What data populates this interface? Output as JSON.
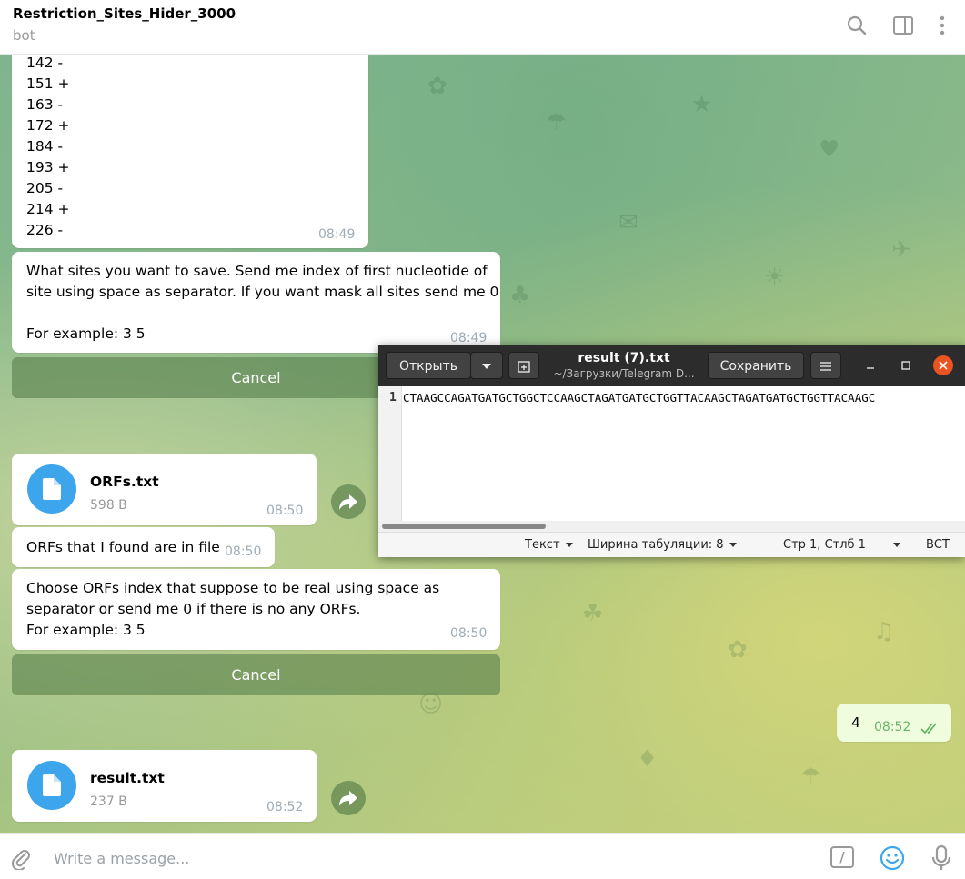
{
  "header": {
    "title": "Restriction_Sites_Hider_3000",
    "subtitle": "bot"
  },
  "messages": {
    "sites_list": {
      "lines": [
        "142 -",
        "151 +",
        "163 -",
        "172 +",
        "184 -",
        "193 +",
        "205 -",
        "214 +",
        "226 -"
      ],
      "time": "08:49"
    },
    "save_prompt": {
      "text": "What sites you want to save. Send me index of first nucleotide of\nsite using space as separator. If you want mask all sites send me 0\n\nFor example: 3 5",
      "time": "08:49",
      "button": "Cancel"
    },
    "orfs_file": {
      "name": "ORFs.txt",
      "size": "598 B",
      "time": "08:50"
    },
    "orfs_found": {
      "text": "ORFs that I found are in file",
      "time": "08:50"
    },
    "orfs_prompt": {
      "text": "Choose ORFs index that suppose to be real using space as\nseparator or send me 0 if there is no any ORFs.\nFor example: 3 5",
      "time": "08:50",
      "button": "Cancel"
    },
    "user_reply": {
      "text": "4",
      "time": "08:52"
    },
    "result_file": {
      "name": "result.txt",
      "size": "237 B",
      "time": "08:52"
    }
  },
  "input": {
    "placeholder": "Write a message...",
    "command_label": "/"
  },
  "editor": {
    "open_label": "Открыть",
    "save_label": "Сохранить",
    "file_name": "result (7).txt",
    "file_path": "~/Загрузки/Telegram D...",
    "line_number": "1",
    "line_text": "CTAAGCCAGATGATGCTGGCTCCAAGCTAGATGATGCTGGTTACAAGCTAGATGATGCTGGTTACAAGC",
    "status": {
      "syntax": "Текст",
      "tab_width": "Ширина табуляции: 8",
      "position": "Стр 1, Стлб 1",
      "mode": "ВСТ"
    }
  },
  "colors": {
    "accent": "#3ca5ec",
    "outgoing_bubble": "#effdde",
    "read_check": "#4fae4e",
    "editor_close": "#e95420"
  }
}
